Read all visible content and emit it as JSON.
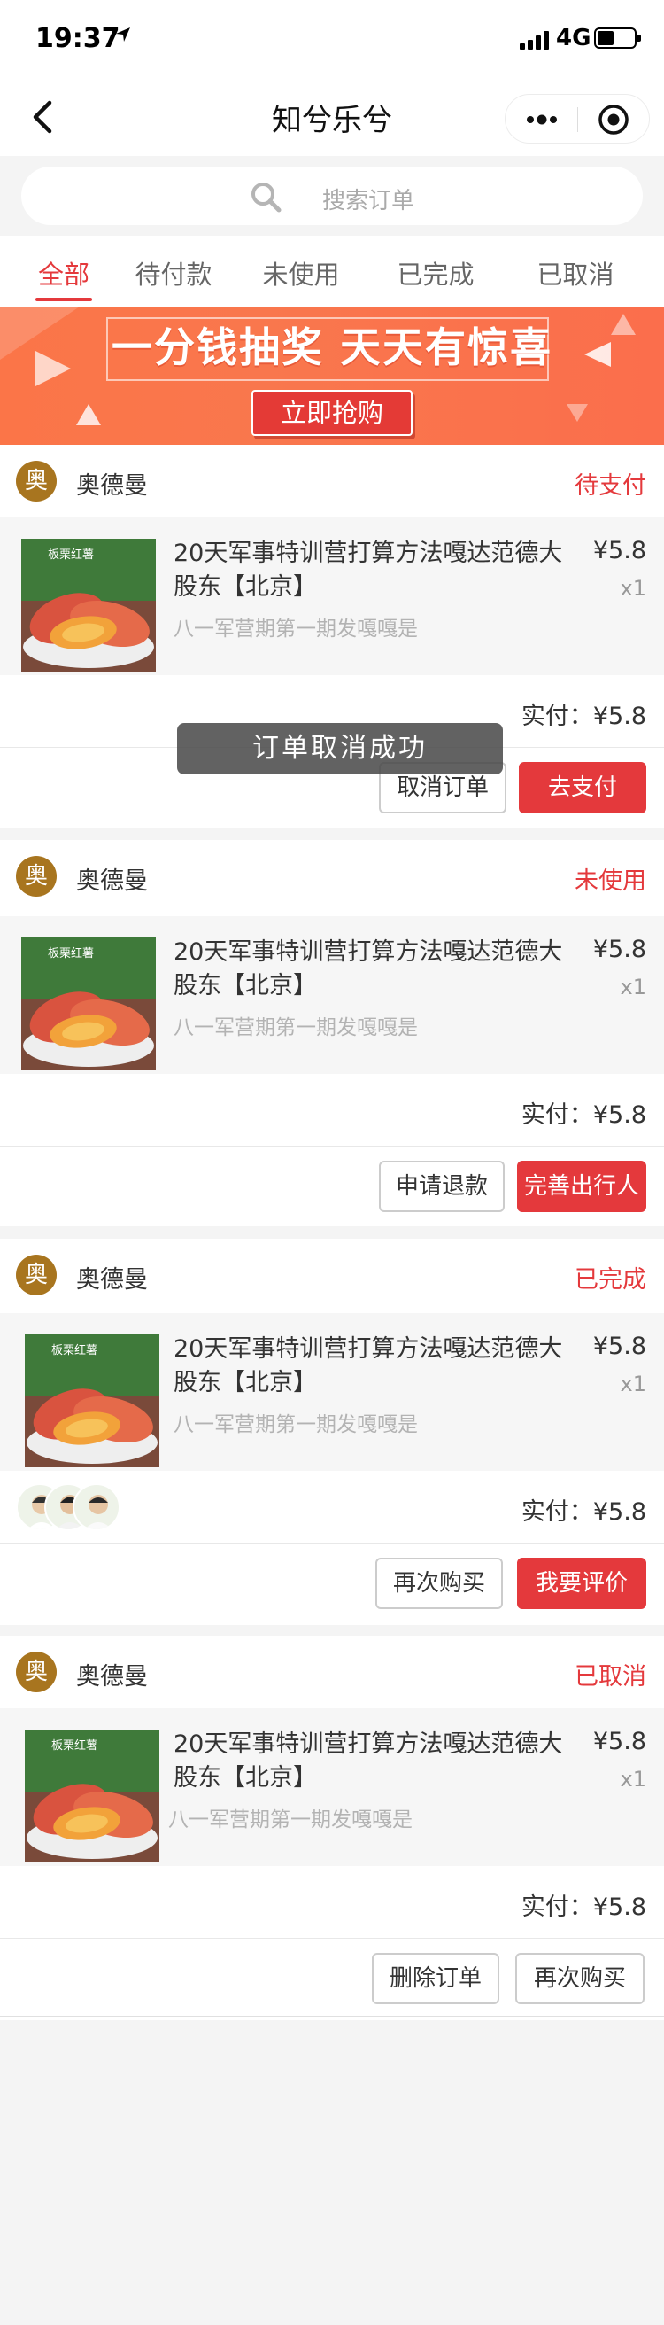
{
  "status_bar": {
    "time": "19:37",
    "network": "4G"
  },
  "nav": {
    "title": "知兮乐兮"
  },
  "search": {
    "placeholder": "搜索订单"
  },
  "tabs": [
    {
      "label": "全部",
      "active": true
    },
    {
      "label": "待付款",
      "active": false
    },
    {
      "label": "未使用",
      "active": false
    },
    {
      "label": "已完成",
      "active": false
    },
    {
      "label": "已取消",
      "active": false
    }
  ],
  "banner": {
    "title": "一分钱抽奖 天天有惊喜",
    "button": "立即抢购"
  },
  "toast": "订单取消成功",
  "orders": [
    {
      "shop_badge": "奥",
      "shop_name": "奥德曼",
      "status": "待支付",
      "product_name": "20天军事特训营打算方法嘎达范德大股东【北京】",
      "spec": "八一军营期第一期发嘎嘎是",
      "price": "¥5.8",
      "qty": "x1",
      "paid": "实付：¥5.8",
      "buttons": [
        "取消订单",
        "去支付"
      ]
    },
    {
      "shop_badge": "奥",
      "shop_name": "奥德曼",
      "status": "未使用",
      "product_name": "20天军事特训营打算方法嘎达范德大股东【北京】",
      "spec": "八一军营期第一期发嘎嘎是",
      "price": "¥5.8",
      "qty": "x1",
      "paid": "实付：¥5.8",
      "buttons": [
        "申请退款",
        "完善出行人"
      ]
    },
    {
      "shop_badge": "奥",
      "shop_name": "奥德曼",
      "status": "已完成",
      "product_name": "20天军事特训营打算方法嘎达范德大股东【北京】",
      "spec": "八一军营期第一期发嘎嘎是",
      "price": "¥5.8",
      "qty": "x1",
      "paid": "实付：¥5.8",
      "buttons": [
        "再次购买",
        "我要评价"
      ]
    },
    {
      "shop_badge": "奥",
      "shop_name": "奥德曼",
      "status": "已取消",
      "product_name": "20天军事特训营打算方法嘎达范德大股东【北京】",
      "spec": "八一军营期第一期发嘎嘎是",
      "price": "¥5.8",
      "qty": "x1",
      "paid": "实付：¥5.8",
      "buttons": [
        "删除订单",
        "再次购买"
      ]
    }
  ],
  "colors": {
    "accent": "#e4393c",
    "shop_badge": "#a8751f",
    "banner": "#fb7548"
  }
}
